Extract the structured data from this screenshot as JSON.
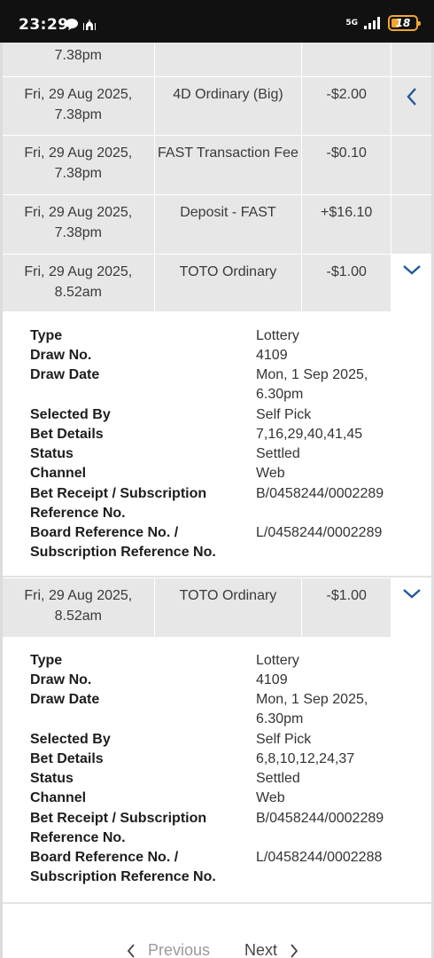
{
  "status_bar": {
    "time": "23:29",
    "network": "5G",
    "battery": "18",
    "left_icons": [
      "chat-bubble-icon",
      "mosque-icon"
    ]
  },
  "partial_row": {
    "date": "7.38pm"
  },
  "transactions": [
    {
      "date_line1": "Fri, 29 Aug 2025,",
      "date_line2": "7.38pm",
      "desc": "4D Ordinary (Big)",
      "amount": "-$2.00",
      "arrow": "chevron-left-icon"
    },
    {
      "date_line1": "Fri, 29 Aug 2025,",
      "date_line2": "7.38pm",
      "desc": "FAST Transaction Fee",
      "amount": "-$0.10",
      "arrow": ""
    },
    {
      "date_line1": "Fri, 29 Aug 2025,",
      "date_line2": "7.38pm",
      "desc": "Deposit - FAST",
      "amount": "+$16.10",
      "arrow": ""
    },
    {
      "date_line1": "Fri, 29 Aug 2025,",
      "date_line2": "8.52am",
      "desc": "TOTO Ordinary",
      "amount": "-$1.00",
      "arrow": "chevron-down-icon"
    },
    {
      "date_line1": "Fri, 29 Aug 2025,",
      "date_line2": "8.52am",
      "desc": "TOTO Ordinary",
      "amount": "-$1.00",
      "arrow": "chevron-down-icon"
    }
  ],
  "details": [
    {
      "type_label": "Type",
      "type": "Lottery",
      "draw_no_label": "Draw No.",
      "draw_no": "4109",
      "draw_date_label": "Draw Date",
      "draw_date_1": "Mon, 1 Sep 2025,",
      "draw_date_2": "6.30pm",
      "selected_by_label": "Selected By",
      "selected_by": "Self Pick",
      "bet_details_label": "Bet Details",
      "bet_details": "7,16,29,40,41,45",
      "status_label": "Status",
      "status": "Settled",
      "channel_label": "Channel",
      "channel": "Web",
      "receipt_label_1": "Bet Receipt / Subscription",
      "receipt_label_2": "Reference No.",
      "receipt": "B/0458244/0002289",
      "board_label_1": "Board Reference No. /",
      "board_label_2": "Subscription Reference No.",
      "board": "L/0458244/0002289"
    },
    {
      "type_label": "Type",
      "type": "Lottery",
      "draw_no_label": "Draw No.",
      "draw_no": "4109",
      "draw_date_label": "Draw Date",
      "draw_date_1": "Mon, 1 Sep 2025,",
      "draw_date_2": "6.30pm",
      "selected_by_label": "Selected By",
      "selected_by": "Self Pick",
      "bet_details_label": "Bet Details",
      "bet_details": "6,8,10,12,24,37",
      "status_label": "Status",
      "status": "Settled",
      "channel_label": "Channel",
      "channel": "Web",
      "receipt_label_1": "Bet Receipt / Subscription",
      "receipt_label_2": "Reference No.",
      "receipt": "B/0458244/0002289",
      "board_label_1": "Board Reference No. /",
      "board_label_2": "Subscription Reference No.",
      "board": "L/0458244/0002288"
    }
  ],
  "pagination": {
    "previous": "Previous",
    "next": "Next"
  },
  "colors": {
    "row_bg": "#e7e7e7",
    "chevron": "#1f5a96",
    "battery": "#f2a531"
  }
}
